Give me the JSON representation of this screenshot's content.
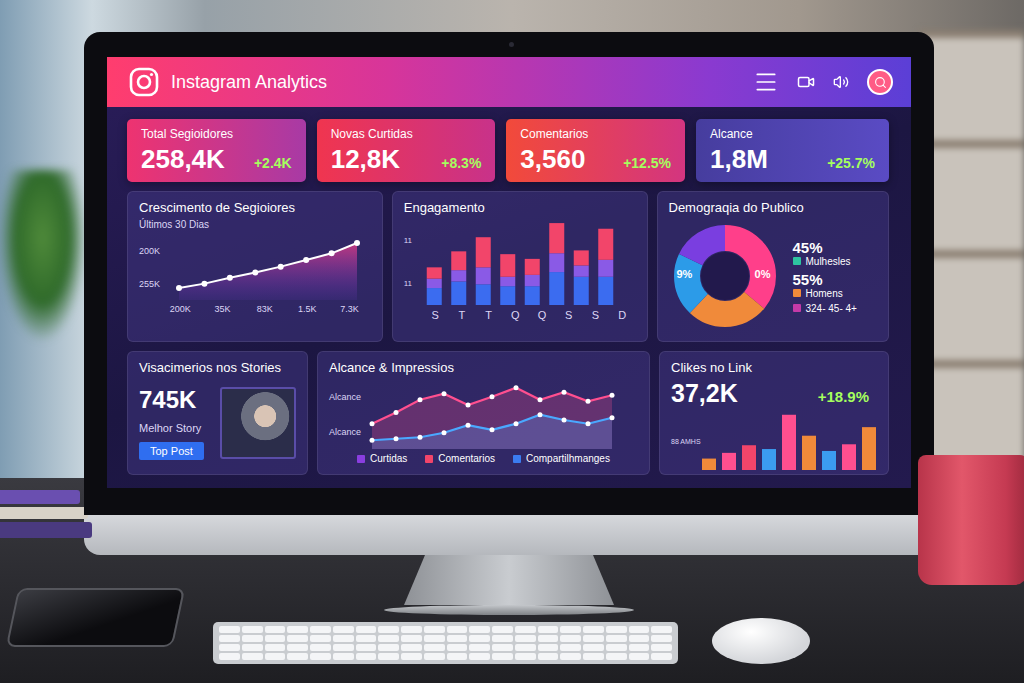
{
  "header": {
    "title": "Instagram Analytics"
  },
  "stats": [
    {
      "label": "Total Segioidores",
      "value": "258,4K",
      "change": "+2.4K"
    },
    {
      "label": "Novas Curtidas",
      "value": "12,8K",
      "change": "+8.3%"
    },
    {
      "label": "Comentarios",
      "value": "3,560",
      "change": "+12.5%"
    },
    {
      "label": "Alcance",
      "value": "1,8M",
      "change": "+25.7%"
    }
  ],
  "growth": {
    "title": "Crescimento de Segioiores",
    "subtitle": "Últimos 30 Dias",
    "y_ticks": [
      "200K",
      "255K"
    ],
    "x_ticks": [
      "200K",
      "35K",
      "83K",
      "1.5K",
      "7.3K"
    ],
    "values": [
      205,
      211,
      219,
      226,
      234,
      243,
      252,
      266
    ]
  },
  "engagement": {
    "title": "Engagamento",
    "y_ticks": [
      "11",
      "11"
    ],
    "days": [
      "S",
      "T",
      "T",
      "Q",
      "Q",
      "S",
      "S",
      "D"
    ],
    "series": [
      {
        "color": "#3b6cf0",
        "values": [
          18,
          25,
          22,
          20,
          20,
          35,
          30,
          30
        ]
      },
      {
        "color": "#8a5ae6",
        "values": [
          10,
          12,
          18,
          10,
          12,
          20,
          12,
          18
        ]
      },
      {
        "color": "#f2456a",
        "values": [
          12,
          20,
          32,
          24,
          17,
          32,
          16,
          33
        ]
      }
    ]
  },
  "demographics": {
    "title": "Demograqia do Publico",
    "donut_labels": [
      "9%",
      "0%"
    ],
    "segments": [
      {
        "share": 0.36,
        "color": "#ff3f8a"
      },
      {
        "share": 0.26,
        "color": "#f08a3a"
      },
      {
        "share": 0.2,
        "color": "#2c9be8"
      },
      {
        "share": 0.18,
        "color": "#7a3ee0"
      }
    ],
    "legend": [
      {
        "value": "45%",
        "label": "Mulhesles",
        "color": "#2ec4a0"
      },
      {
        "value": "55%",
        "label": "Homens",
        "color": "#f08a3a"
      }
    ],
    "ages": {
      "label": "324- 45- 4+",
      "color": "#c43aa8"
    }
  },
  "stories": {
    "title": "Visacimerios nos Stories",
    "value": "745K",
    "caption": "Melhor Story",
    "button": "Top Post"
  },
  "reach": {
    "title": "Alcance & Impressios",
    "axis_labels": [
      "Alcance",
      "Alcance"
    ],
    "series": [
      {
        "color": "#ff4f8f",
        "values": [
          30,
          45,
          62,
          70,
          55,
          66,
          78,
          62,
          72,
          60,
          68
        ]
      },
      {
        "color": "#4aa8ff",
        "values": [
          8,
          10,
          12,
          18,
          28,
          22,
          30,
          42,
          35,
          30,
          38
        ]
      }
    ],
    "legend": [
      {
        "label": "Curtidas",
        "color": "#8a3ee0"
      },
      {
        "label": "Comentarios",
        "color": "#f2456a"
      },
      {
        "label": "Compartilhmanges",
        "color": "#3b7cf0"
      }
    ]
  },
  "clicks": {
    "title": "Clikes no Link",
    "value": "37,2K",
    "change": "+18.9%",
    "bar_label": "88 AMHS",
    "bars": [
      {
        "value": 12,
        "color": "#f08a3a"
      },
      {
        "value": 18,
        "color": "#ff4f8f"
      },
      {
        "value": 26,
        "color": "#f2456a"
      },
      {
        "value": 22,
        "color": "#3b9cf0"
      },
      {
        "value": 58,
        "color": "#ff4f8f"
      },
      {
        "value": 36,
        "color": "#f08a3a"
      },
      {
        "value": 20,
        "color": "#3b9cf0"
      },
      {
        "value": 27,
        "color": "#ff4f8f"
      },
      {
        "value": 45,
        "color": "#f08a3a"
      }
    ]
  }
}
